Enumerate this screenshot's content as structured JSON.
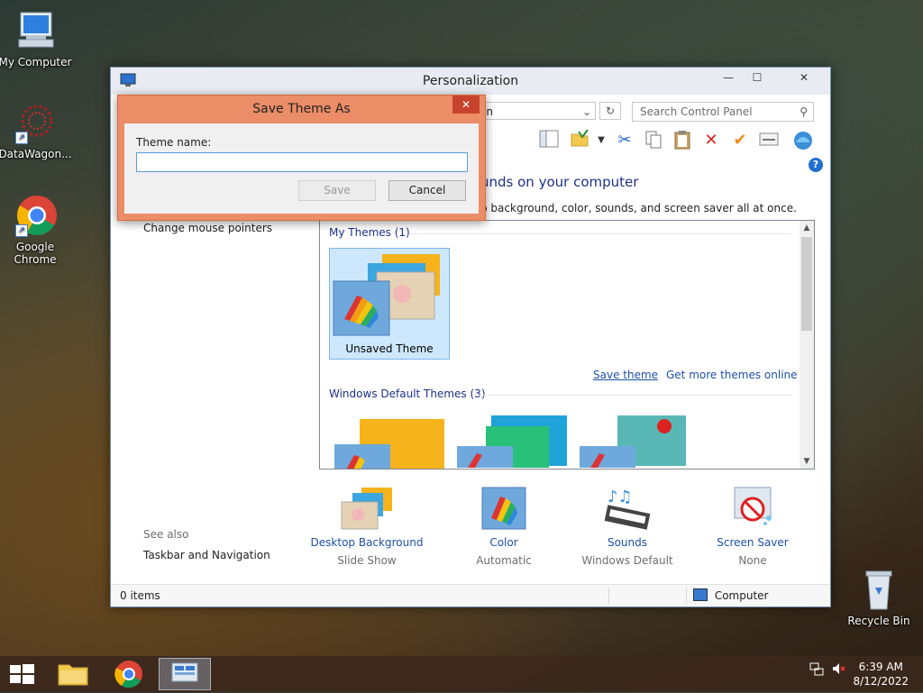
{
  "desktop": {
    "icons": [
      {
        "label": "My Computer"
      },
      {
        "label": "DataWagon..."
      },
      {
        "label": "Google Chrome"
      },
      {
        "label": "Recycle Bin"
      }
    ]
  },
  "window": {
    "title": "Personalization",
    "address_text": "on",
    "search_placeholder": "Search Control Panel",
    "heading_fragment": "unds on your computer",
    "subheading_fragment": "p background, color, sounds, and screen saver all at once.",
    "left_links": {
      "change_mouse": "Change mouse pointers",
      "see_also": "See also",
      "taskbar_nav": "Taskbar and Navigation"
    },
    "themes": {
      "my_themes_group": "My Themes (1)",
      "unsaved_theme_label": "Unsaved Theme",
      "save_theme_link": "Save theme",
      "get_more_link": "Get more themes online",
      "windows_default_group": "Windows Default Themes (3)"
    },
    "bottom_tiles": [
      {
        "title": "Desktop Background",
        "subtitle": "Slide Show"
      },
      {
        "title": "Color",
        "subtitle": "Automatic"
      },
      {
        "title": "Sounds",
        "subtitle": "Windows Default"
      },
      {
        "title": "Screen Saver",
        "subtitle": "None"
      }
    ],
    "status": {
      "items": "0 items",
      "location": "Computer"
    }
  },
  "dialog": {
    "title": "Save Theme As",
    "label": "Theme name:",
    "input_value": "",
    "save_label": "Save",
    "cancel_label": "Cancel",
    "close_glyph": "✕"
  },
  "taskbar": {
    "time": "6:39 AM",
    "date": "8/12/2022"
  },
  "colors": {
    "dialog_frame": "#eb8d67",
    "link_blue": "#1e50a8",
    "heading_blue": "#1e3287"
  }
}
